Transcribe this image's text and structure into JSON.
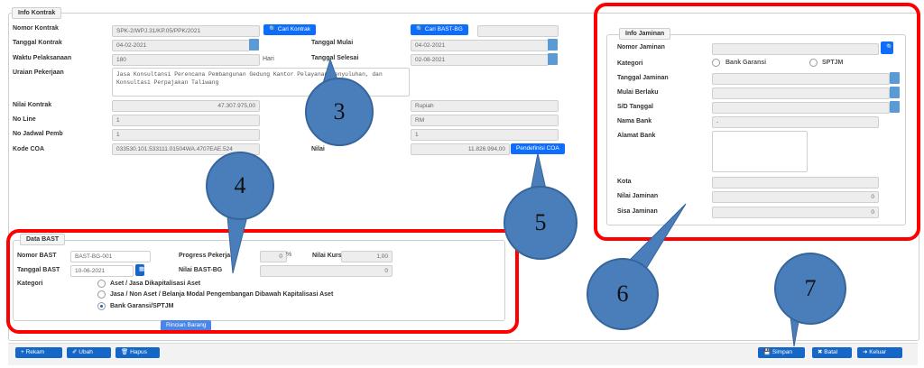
{
  "kontrak": {
    "legend": "Info Kontrak",
    "nomor_label": "Nomor Kontrak",
    "nomor_value": "SPK-2/WPJ.31/KP.05/PPK/2021",
    "cari_kontrak": "Cari Kontrak",
    "cari_bast": "Cari BAST-BG",
    "bast_value": "",
    "tanggal_label": "Tanggal Kontrak",
    "tanggal_value": "04-02-2021",
    "mulai_label": "Tanggal Mulai",
    "mulai_value": "04-02-2021",
    "waktu_label": "Waktu Pelaksanaan",
    "waktu_value": "180",
    "hari": "Hari",
    "selesai_label": "Tanggal Selesai",
    "selesai_value": "02-08-2021",
    "uraian_label": "Uraian Pekerjaan",
    "uraian_value": "Jasa Konsultansi Perencana Pembangunan Gedung Kantor Pelayanan Penyuluhan, dan Konsultasi Perpajakan Taliwang",
    "nilai_label": "Nilai Kontrak",
    "nilai_value": "47.307.975,00",
    "rupiah": "Rupiah",
    "noline_label": "No Line",
    "noline_value": "1",
    "rm": "RM",
    "jadwal_label": "No Jadwal Pemb",
    "jadwal_value": "1",
    "jadwal_value2": "1",
    "coa_label": "Kode COA",
    "coa_value": "033530.101.533111.01504WA.4707EAE.524",
    "nilai2_label": "Nilai",
    "nilai2_value": "11.826.994,00",
    "pendefinisi_coa": "Pendefinisi COA"
  },
  "jaminan": {
    "legend": "Info Jaminan",
    "nomor_label": "Nomor Jaminan",
    "kategori_label": "Kategori",
    "opt1": "Bank Garansi",
    "opt2": "SPTJM",
    "tanggal_label": "Tanggal Jaminan",
    "mulai_label": "Mulai Berlaku",
    "sd_label": "S/D Tanggal",
    "bank_label": "Nama Bank",
    "bank_value": "-",
    "alamat_label": "Alamat Bank",
    "kota_label": "Kota",
    "nilai_label": "Nilai Jaminan",
    "nilai_value": "0",
    "sisa_label": "Sisa Jaminan",
    "sisa_value": "0"
  },
  "bast": {
    "legend": "Data BAST",
    "nomor_label": "Nomor BAST",
    "nomor_value": "BAST-BG-001",
    "tanggal_label": "Tanggal BAST",
    "tanggal_value": "10-06-2021",
    "progress_label": "Progress Pekerjaan",
    "progress_value": "0",
    "percent": "%",
    "kurs_label": "Nilai Kurs",
    "kurs_value": "1,00",
    "nilai_label": "Nilai BAST-BG",
    "nilai_value": "0",
    "kategori_label": "Kategori",
    "opt1": "Aset / Jasa Dikapitalisasi Aset",
    "opt2": "Jasa / Non Aset / Belanja Modal Pengembangan Dibawah Kapitalisasi Aset",
    "opt3": "Bank Garansi/SPTJM",
    "rincian": "Rincian Barang"
  },
  "toolbar": {
    "rekam": "Rekam",
    "ubah": "Ubah",
    "hapus": "Hapus",
    "simpan": "Simpan",
    "batal": "Batal",
    "keluar": "Keluar"
  },
  "callouts": [
    "3",
    "4",
    "5",
    "6",
    "7"
  ],
  "colors": {
    "primary": "#1466c7",
    "highlight": "#ff0000",
    "callout": "#4a7ebb"
  }
}
